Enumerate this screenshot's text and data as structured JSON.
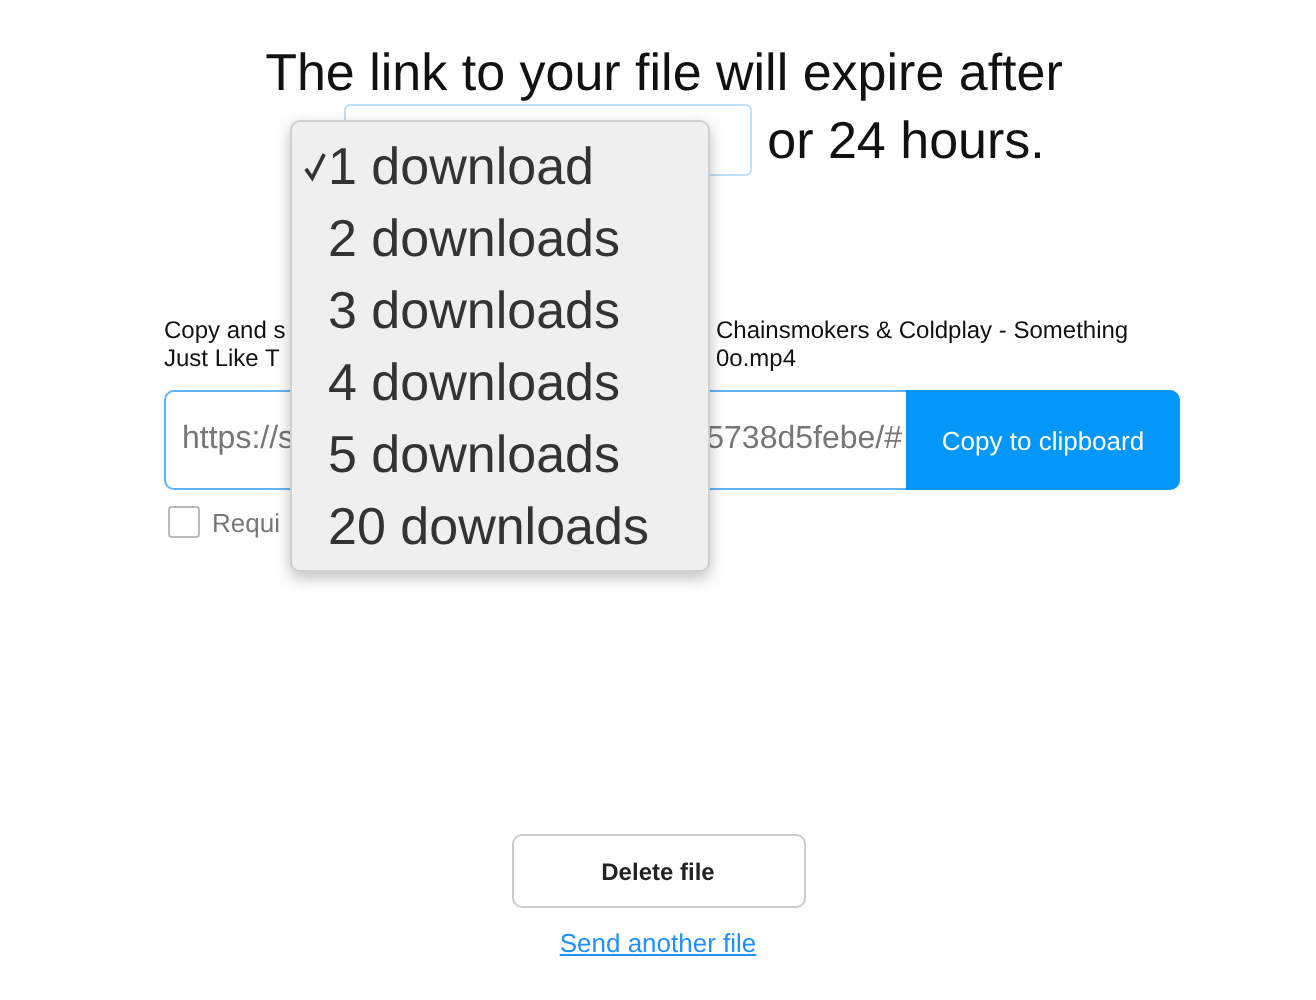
{
  "heading": {
    "line_1": "The link to your file will expire after",
    "line_2_suffix": "or 24 hours."
  },
  "expiry_menu": {
    "items": [
      {
        "label": "1 download",
        "selected": true
      },
      {
        "label": "2 downloads",
        "selected": false
      },
      {
        "label": "3 downloads",
        "selected": false
      },
      {
        "label": "4 downloads",
        "selected": false
      },
      {
        "label": "5 downloads",
        "selected": false
      },
      {
        "label": "20 downloads",
        "selected": false
      }
    ]
  },
  "description": {
    "lines": [
      {
        "start": "Copy and s",
        "end": "Chainsmokers & Coldplay - Something"
      },
      {
        "start": "Just Like T",
        "end": "0o.mp4"
      }
    ]
  },
  "link_field": {
    "value_start": "https://s",
    "value_end": "5738d5febe/#"
  },
  "copy_button": "Copy to clipboard",
  "password_checkbox": {
    "label": "Requi",
    "checked": false
  },
  "delete_button": "Delete file",
  "send_another_link": "Send another file"
}
